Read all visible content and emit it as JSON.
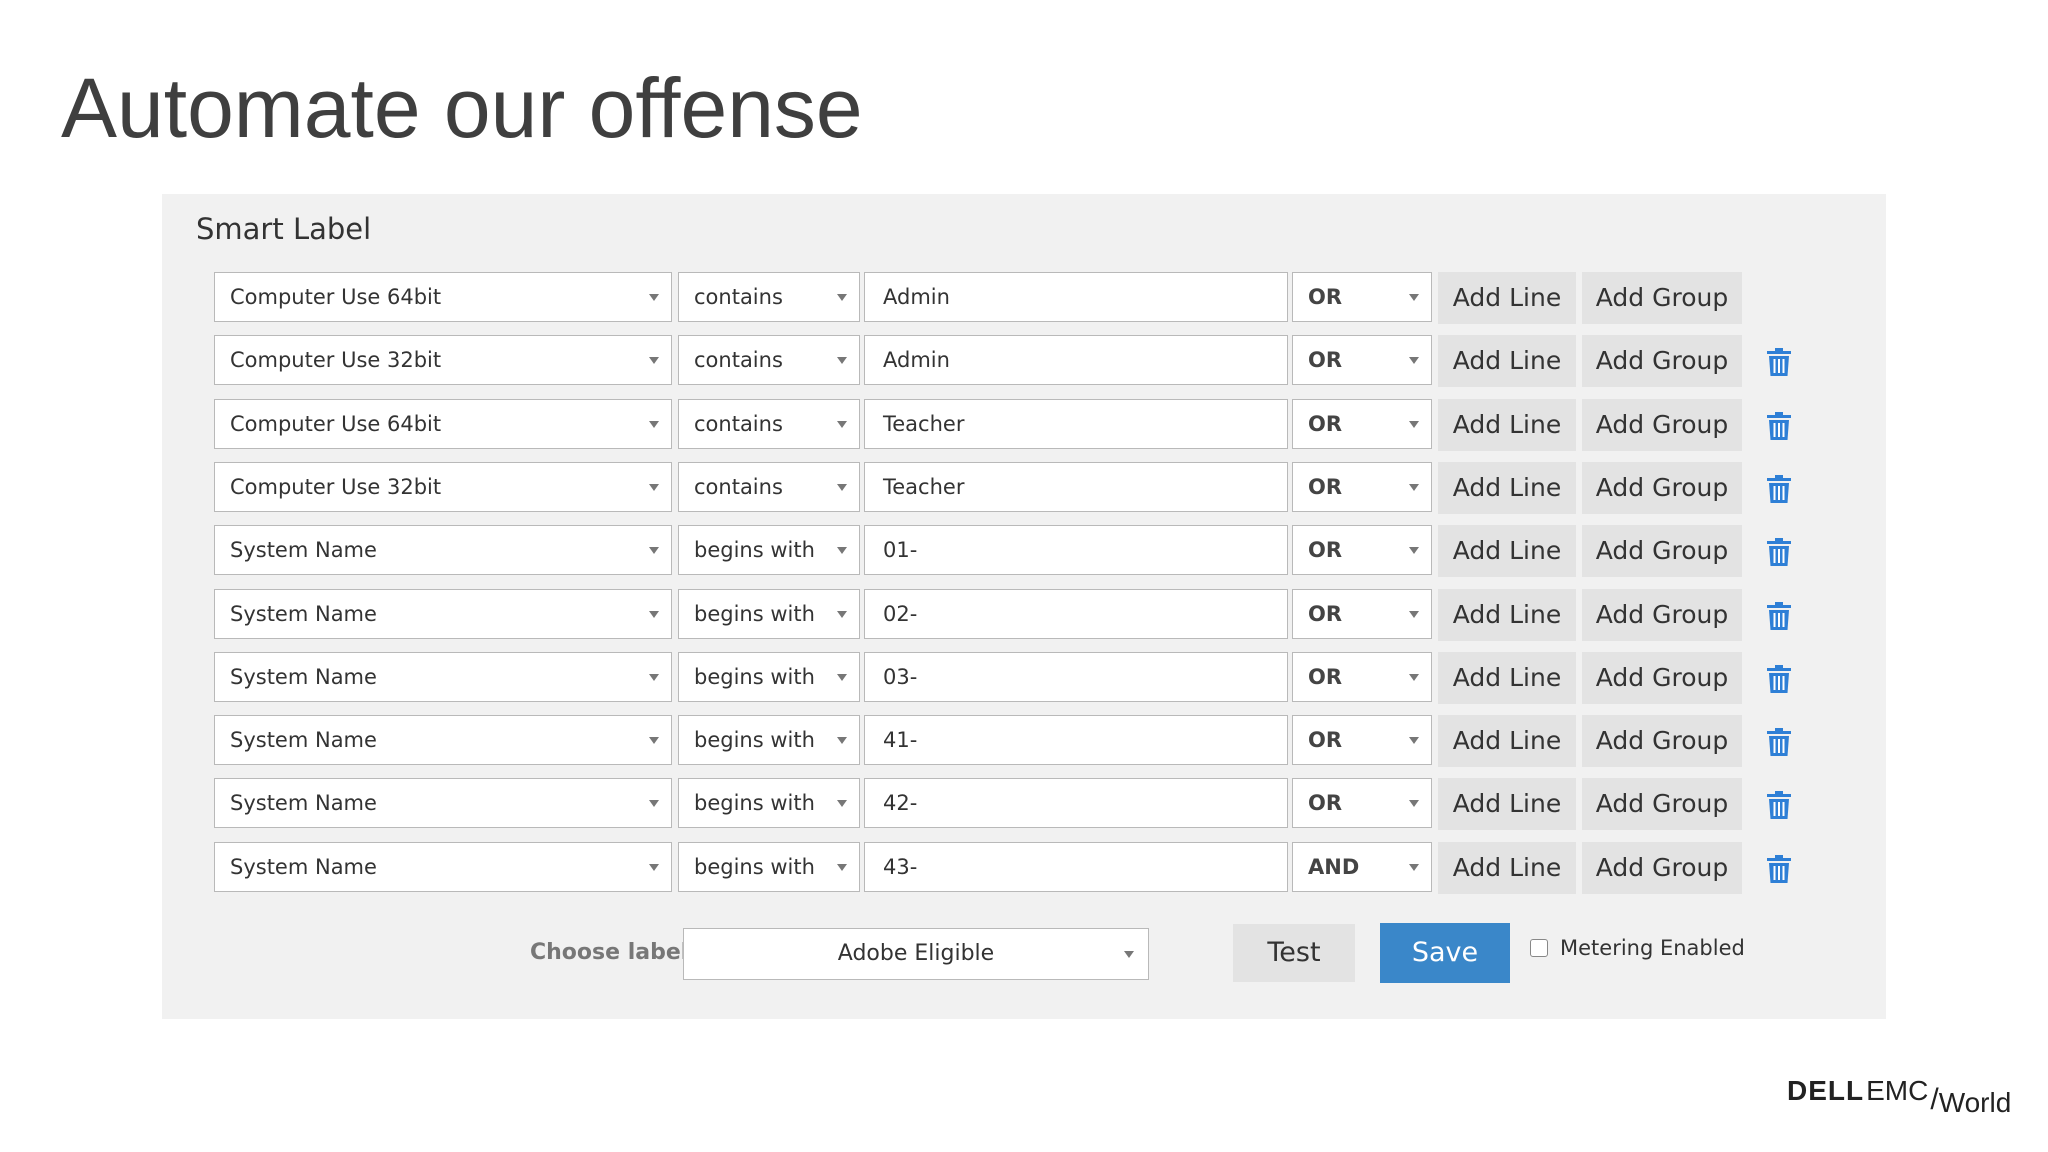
{
  "slide": {
    "title": "Automate our offense"
  },
  "panel": {
    "title": "Smart Label"
  },
  "buttons": {
    "add_line": "Add Line",
    "add_group": "Add Group"
  },
  "rows": [
    {
      "field": "Computer Use 64bit",
      "operator": "contains",
      "value": "Admin",
      "conjunction": "OR",
      "deletable": false
    },
    {
      "field": "Computer Use 32bit",
      "operator": "contains",
      "value": "Admin",
      "conjunction": "OR",
      "deletable": true
    },
    {
      "field": "Computer Use 64bit",
      "operator": "contains",
      "value": "Teacher",
      "conjunction": "OR",
      "deletable": true
    },
    {
      "field": "Computer Use 32bit",
      "operator": "contains",
      "value": "Teacher",
      "conjunction": "OR",
      "deletable": true
    },
    {
      "field": "System Name",
      "operator": "begins with",
      "value": "01-",
      "conjunction": "OR",
      "deletable": true
    },
    {
      "field": "System Name",
      "operator": "begins with",
      "value": "02-",
      "conjunction": "OR",
      "deletable": true
    },
    {
      "field": "System Name",
      "operator": "begins with",
      "value": "03-",
      "conjunction": "OR",
      "deletable": true
    },
    {
      "field": "System Name",
      "operator": "begins with",
      "value": "41-",
      "conjunction": "OR",
      "deletable": true
    },
    {
      "field": "System Name",
      "operator": "begins with",
      "value": "42-",
      "conjunction": "OR",
      "deletable": true
    },
    {
      "field": "System Name",
      "operator": "begins with",
      "value": "43-",
      "conjunction": "AND",
      "deletable": true
    }
  ],
  "footer": {
    "choose_label": "Choose label:",
    "label_value": "Adobe Eligible",
    "test_label": "Test",
    "save_label": "Save",
    "metering_label": "Metering Enabled",
    "metering_checked": false
  },
  "colors": {
    "accent": "#3a87c9",
    "trash_icon": "#2e7fd6",
    "panel_bg": "#f1f1f1"
  },
  "logo": {
    "dell": "DELL",
    "emc": "EMC",
    "world": "World"
  }
}
